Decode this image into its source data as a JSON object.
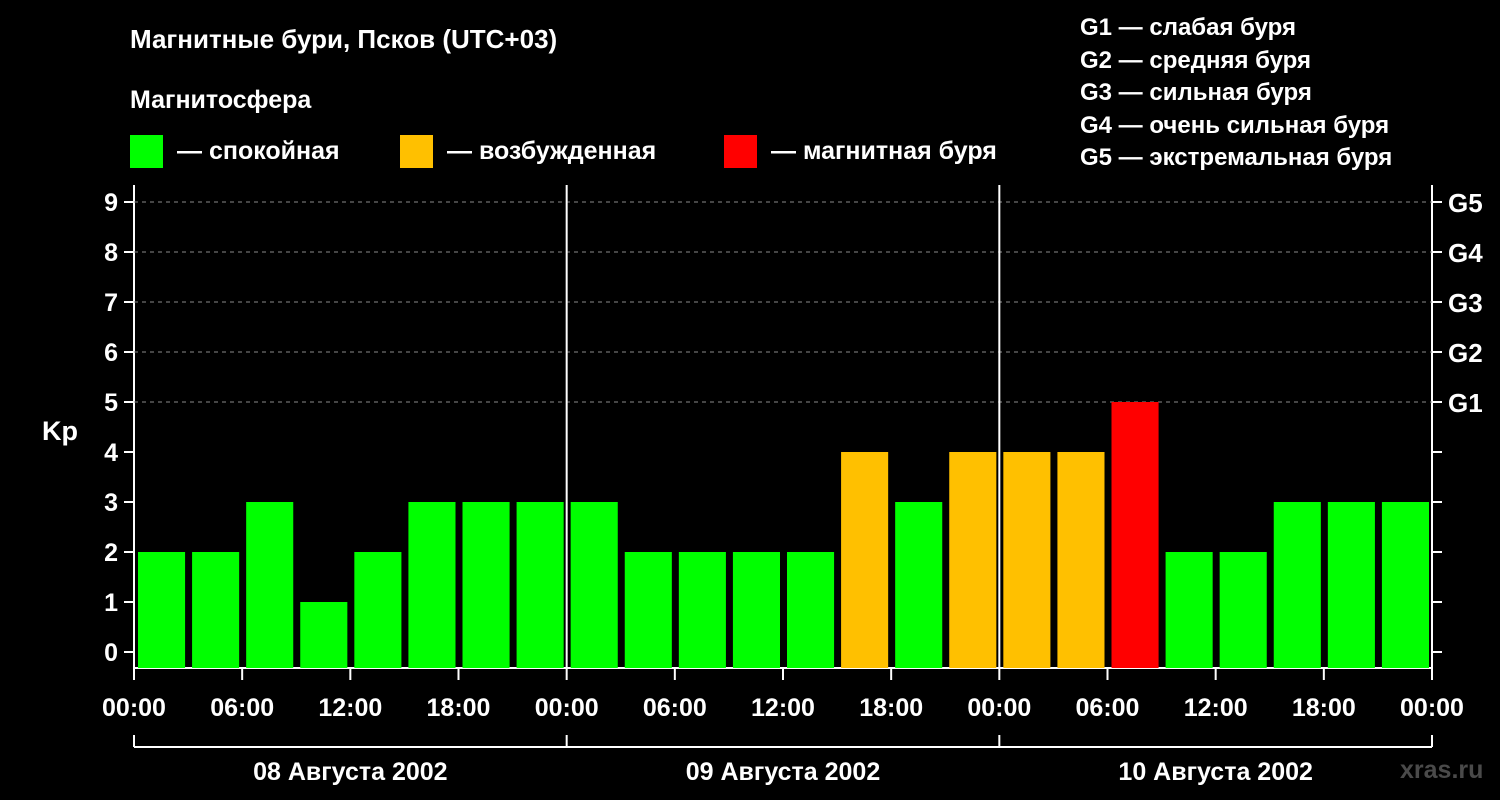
{
  "header": {
    "title": "Магнитные бури, Псков (UTC+03)",
    "subtitle": "Магнитосфера"
  },
  "legend": [
    {
      "label": "— спокойная",
      "color": "#00ff00"
    },
    {
      "label": "— возбужденная",
      "color": "#ffc000"
    },
    {
      "label": "— магнитная буря",
      "color": "#ff0000"
    }
  ],
  "g_scale": [
    "G1 — слабая буря",
    "G2 — средняя буря",
    "G3 — сильная буря",
    "G4 — очень сильная буря",
    "G5 — экстремальная буря"
  ],
  "watermark": "xras.ru",
  "chart_data": {
    "type": "bar",
    "ylabel": "Kp",
    "ylim": [
      0,
      9
    ],
    "yticks": [
      "0",
      "1",
      "2",
      "3",
      "4",
      "5",
      "6",
      "7",
      "8",
      "9"
    ],
    "right_ticks": [
      {
        "value": 5,
        "label": "G1"
      },
      {
        "value": 6,
        "label": "G2"
      },
      {
        "value": 7,
        "label": "G3"
      },
      {
        "value": 8,
        "label": "G4"
      },
      {
        "value": 9,
        "label": "G5"
      }
    ],
    "grid": "horizontal dashed at 5-9",
    "xticks": [
      "00:00",
      "06:00",
      "12:00",
      "18:00",
      "00:00",
      "06:00",
      "12:00",
      "18:00",
      "00:00",
      "06:00",
      "12:00",
      "18:00",
      "00:00"
    ],
    "days": [
      "08 Августа 2002",
      "09 Августа 2002",
      "10 Августа 2002"
    ],
    "values": [
      2,
      2,
      3,
      1,
      2,
      3,
      3,
      3,
      3,
      2,
      2,
      2,
      2,
      4,
      3,
      4,
      4,
      4,
      5,
      2,
      2,
      3,
      3,
      3
    ],
    "colors": {
      "quiet": "#00ff00",
      "active": "#ffc000",
      "storm": "#ff0000"
    }
  }
}
